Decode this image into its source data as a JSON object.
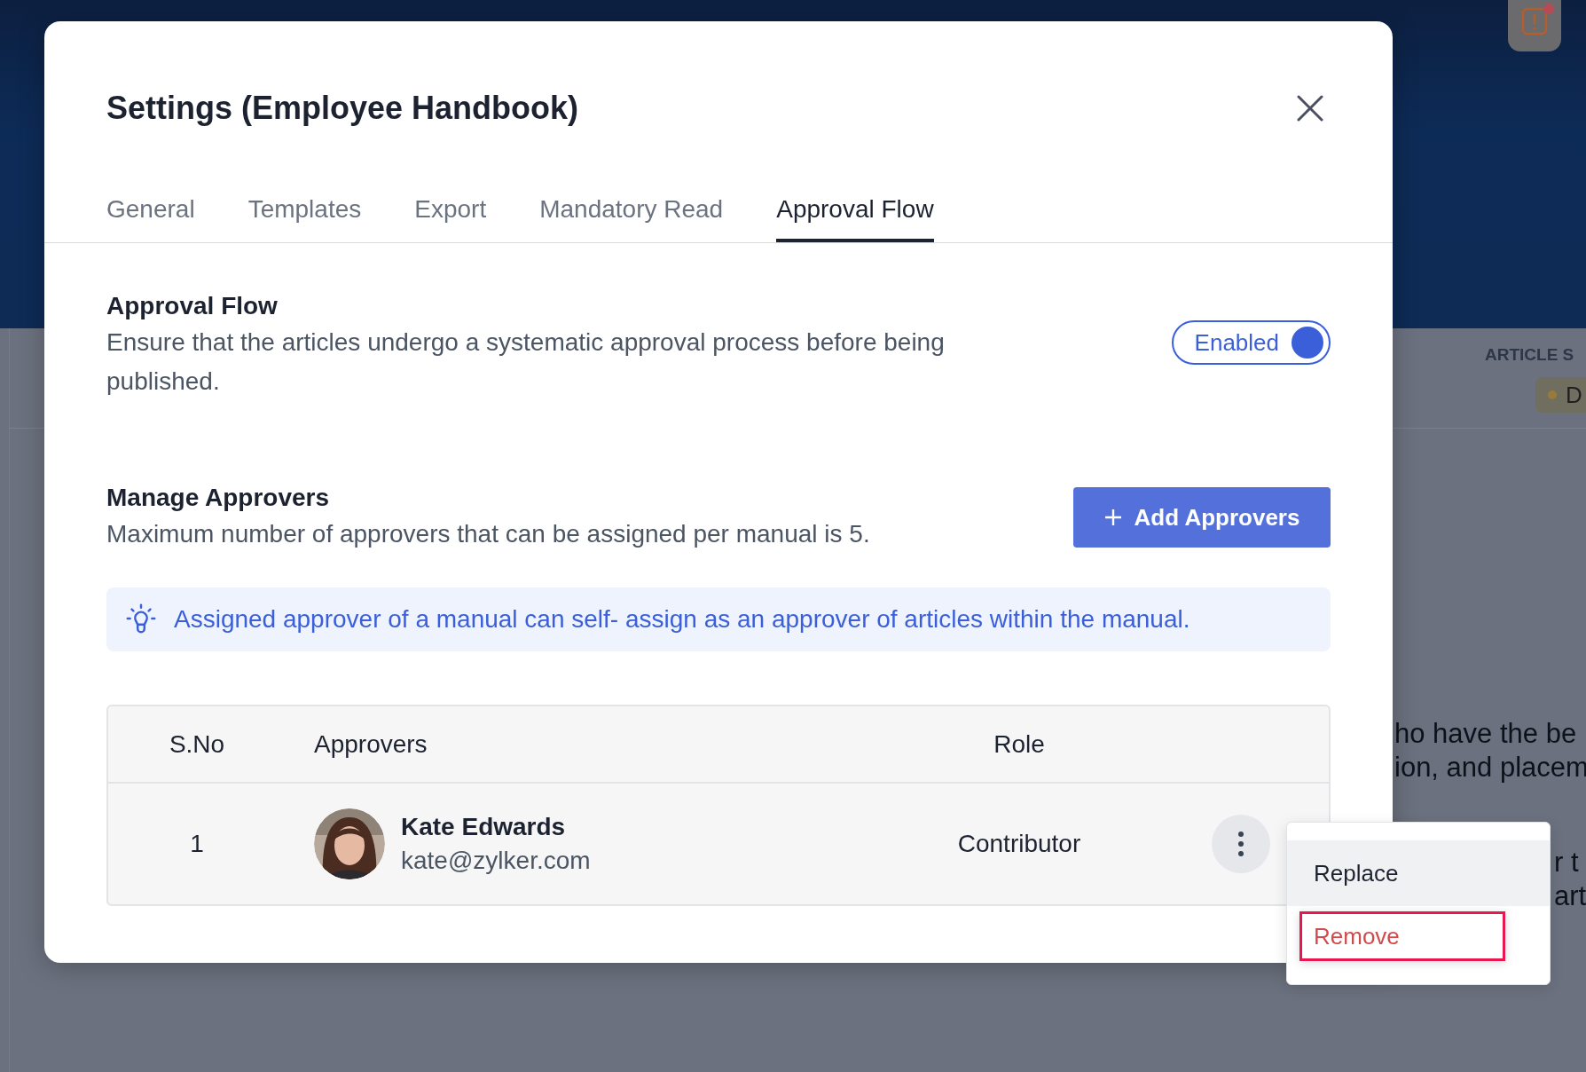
{
  "background": {
    "section_label": "ARTICLE S",
    "status_chip": {
      "label": "D",
      "color": "#9a7a3a"
    },
    "text_lines": [
      "ho have the be",
      "ion, and placem"
    ],
    "text_lines_lower": [
      "r t",
      "art"
    ]
  },
  "dialog": {
    "title": "Settings (Employee Handbook)",
    "tabs": [
      {
        "label": "General",
        "selected": false
      },
      {
        "label": "Templates",
        "selected": false
      },
      {
        "label": "Export",
        "selected": false
      },
      {
        "label": "Mandatory Read",
        "selected": false
      },
      {
        "label": "Approval Flow",
        "selected": true
      }
    ],
    "approval_flow": {
      "heading": "Approval Flow",
      "description": "Ensure that the articles undergo a systematic approval process before being published.",
      "toggle": {
        "label": "Enabled",
        "on": true
      }
    },
    "approvers": {
      "heading": "Manage Approvers",
      "description": "Maximum number of approvers that can be assigned per manual is 5.",
      "add_button": "Add Approvers",
      "tip": "Assigned approver of a manual can self- assign as an approver of articles within the manual.",
      "table": {
        "columns": [
          "S.No",
          "Approvers",
          "Role"
        ],
        "rows": [
          {
            "sno": "1",
            "name": "Kate Edwards",
            "email": "kate@zylker.com",
            "role": "Contributor",
            "menu_open": true
          }
        ]
      }
    },
    "menu": {
      "items": [
        {
          "label": "Replace",
          "kind": "normal",
          "hovered": true,
          "highlighted": false
        },
        {
          "label": "Remove",
          "kind": "danger",
          "hovered": false,
          "highlighted": true
        }
      ]
    }
  }
}
